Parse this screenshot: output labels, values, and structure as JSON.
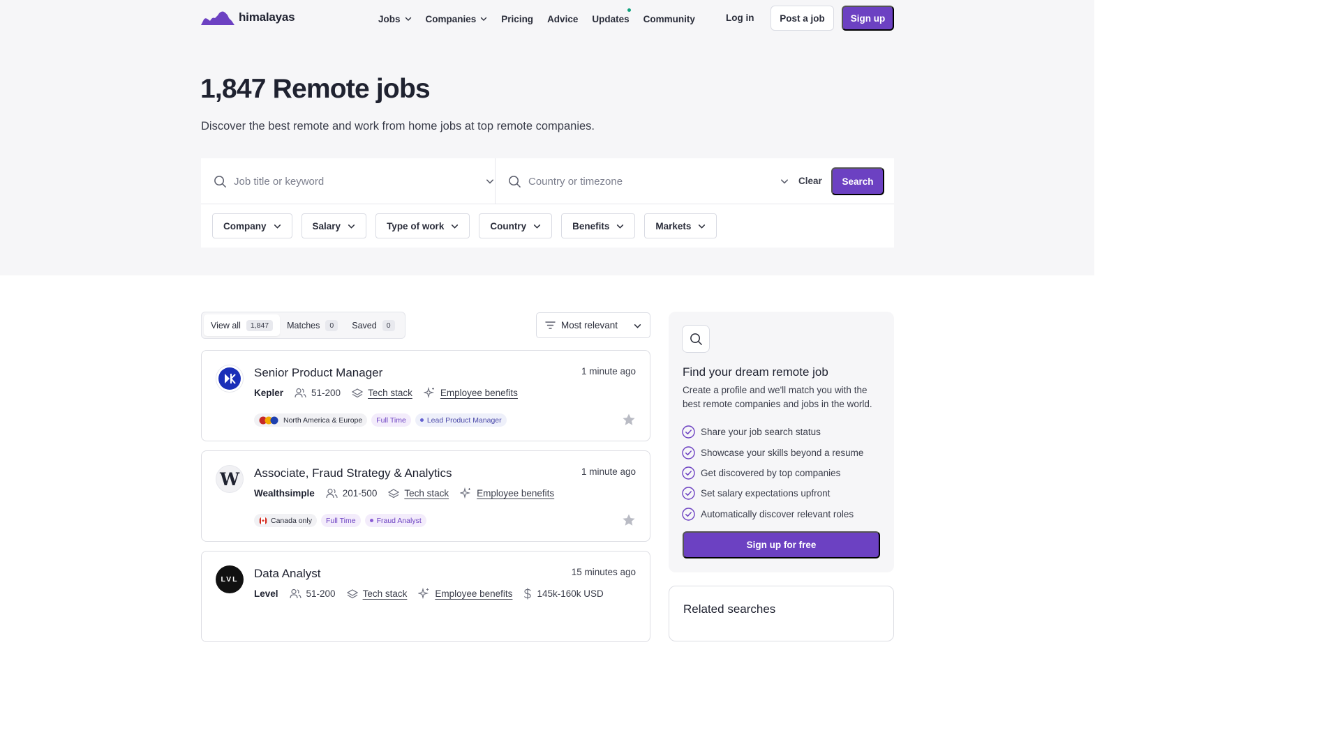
{
  "brand": {
    "name": "himalayas",
    "accent": "#6c41c2"
  },
  "nav": {
    "items": [
      {
        "label": "Jobs",
        "has_dropdown": true
      },
      {
        "label": "Companies",
        "has_dropdown": true
      },
      {
        "label": "Pricing",
        "has_dropdown": false
      },
      {
        "label": "Advice",
        "has_dropdown": false
      },
      {
        "label": "Updates",
        "has_dropdown": false,
        "has_dot": true
      },
      {
        "label": "Community",
        "has_dropdown": false
      }
    ],
    "login": "Log in",
    "post_job": "Post a job",
    "signup": "Sign up"
  },
  "hero": {
    "title": "1,847 Remote jobs",
    "subtitle": "Discover the best remote and work from home jobs at top remote companies."
  },
  "search": {
    "keyword_placeholder": "Job title or keyword",
    "location_placeholder": "Country or timezone",
    "clear": "Clear",
    "submit": "Search",
    "filters": [
      "Company",
      "Salary",
      "Type of work",
      "Country",
      "Benefits",
      "Markets"
    ]
  },
  "tabs": [
    {
      "label": "View all",
      "count": "1,847",
      "active": true
    },
    {
      "label": "Matches",
      "count": "0",
      "active": false
    },
    {
      "label": "Saved",
      "count": "0",
      "active": false
    }
  ],
  "sort": {
    "label": "Most relevant"
  },
  "jobs": [
    {
      "title": "Senior Product Manager",
      "company": "Kepler",
      "size": "51-200",
      "tech_stack": "Tech stack",
      "benefits": "Employee benefits",
      "posted": "1 minute ago",
      "location": "North America & Europe",
      "type": "Full Time",
      "role": "Lead Product Manager"
    },
    {
      "title": "Associate, Fraud Strategy & Analytics",
      "company": "Wealthsimple",
      "size": "201-500",
      "tech_stack": "Tech stack",
      "benefits": "Employee benefits",
      "posted": "1 minute ago",
      "location": "Canada only",
      "type": "Full Time",
      "role": "Fraud Analyst"
    },
    {
      "title": "Data Analyst",
      "company": "Level",
      "size": "51-200",
      "tech_stack": "Tech stack",
      "benefits": "Employee benefits",
      "salary": "145k-160k USD",
      "posted": "15 minutes ago",
      "logo_text": "LVL"
    }
  ],
  "promo": {
    "title": "Find your dream remote job",
    "description": "Create a profile and we'll match you with the best remote companies and jobs in the world.",
    "checks": [
      "Share your job search status",
      "Showcase your skills beyond a resume",
      "Get discovered by top companies",
      "Set salary expectations upfront",
      "Automatically discover relevant roles"
    ],
    "cta": "Sign up for free"
  },
  "related": {
    "title": "Related searches"
  }
}
